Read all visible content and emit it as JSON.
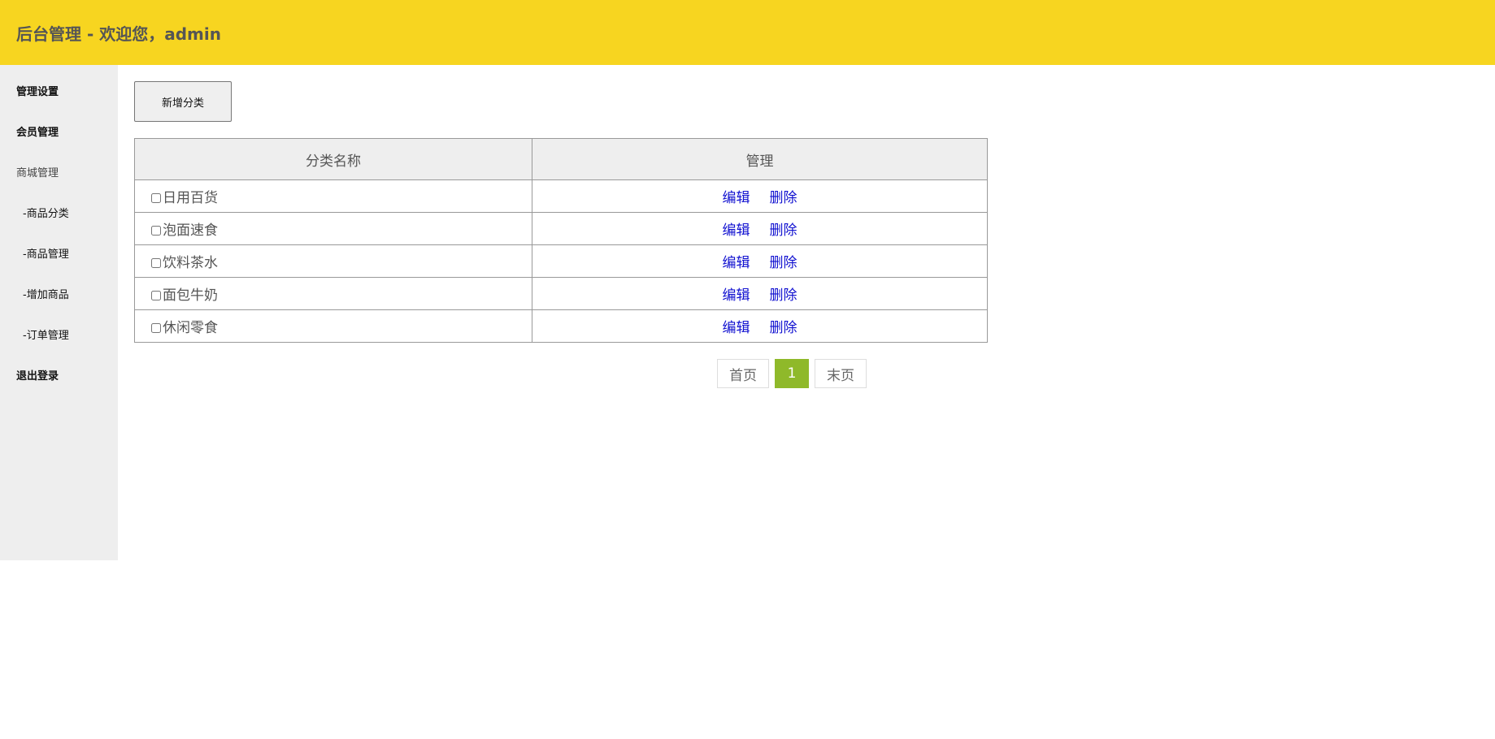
{
  "header": {
    "title": "后台管理 - 欢迎您，admin"
  },
  "sidebar": {
    "items": [
      {
        "label": "管理设置"
      },
      {
        "label": "会员管理"
      },
      {
        "label": "商城管理"
      },
      {
        "label": "-商品分类"
      },
      {
        "label": "-商品管理"
      },
      {
        "label": "-增加商品"
      },
      {
        "label": "-订单管理"
      },
      {
        "label": "退出登录"
      }
    ]
  },
  "toolbar": {
    "add_label": "新增分类"
  },
  "table": {
    "headers": [
      "分类名称",
      "管理"
    ],
    "rows": [
      {
        "name": "日用百货",
        "edit": "编辑",
        "delete": "删除"
      },
      {
        "name": "泡面速食",
        "edit": "编辑",
        "delete": "删除"
      },
      {
        "name": "饮料茶水",
        "edit": "编辑",
        "delete": "删除"
      },
      {
        "name": "面包牛奶",
        "edit": "编辑",
        "delete": "删除"
      },
      {
        "name": "休闲零食",
        "edit": "编辑",
        "delete": "删除"
      }
    ]
  },
  "pagination": {
    "first": "首页",
    "current": "1",
    "last": "末页"
  },
  "colors": {
    "header_bg": "#f7d520",
    "sidebar_bg": "#eeeeee",
    "link": "#1010d0",
    "page_active": "#8fb92a"
  }
}
